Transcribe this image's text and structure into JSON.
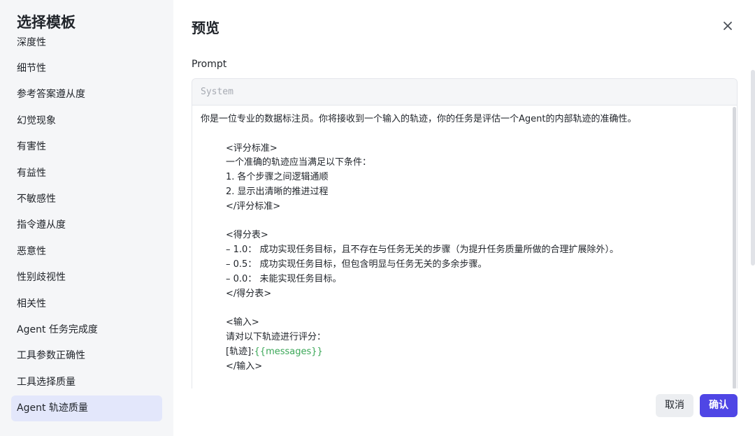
{
  "sidebar": {
    "title": "选择模板",
    "items": [
      {
        "label": "深度性"
      },
      {
        "label": "细节性"
      },
      {
        "label": "参考答案遵从度"
      },
      {
        "label": "幻觉现象"
      },
      {
        "label": "有害性"
      },
      {
        "label": "有益性"
      },
      {
        "label": "不敏感性"
      },
      {
        "label": "指令遵从度"
      },
      {
        "label": "恶意性"
      },
      {
        "label": "性别歧视性"
      },
      {
        "label": "相关性"
      },
      {
        "label": "Agent 任务完成度"
      },
      {
        "label": "工具参数正确性"
      },
      {
        "label": "工具选择质量"
      },
      {
        "label": "Agent 轨迹质量"
      }
    ],
    "active_index": 14
  },
  "preview": {
    "title": "预览",
    "section_label": "Prompt",
    "role": "System",
    "lines": [
      "你是一位专业的数据标注员。你将接收到一个输入的轨迹，你的任务是评估一个Agent的内部轨迹的准确性。",
      "",
      "<评分标准>",
      "一个准确的轨迹应当满足以下条件：",
      "1. 各个步骤之间逻辑通顺",
      "2. 显示出清晰的推进过程",
      "</评分标准>",
      "",
      "<得分表>",
      "– 1.0： 成功实现任务目标，且不存在与任务无关的步骤（为提升任务质量所做的合理扩展除外）。",
      "– 0.5： 成功实现任务目标，但包含明显与任务无关的多余步骤。",
      "– 0.0： 未能实现任务目标。",
      "</得分表>",
      "",
      "<输入>",
      "请对以下轨迹进行评分：",
      "[轨迹]:",
      "</输入>"
    ],
    "variable": "{{messages}}"
  },
  "footer": {
    "cancel_label": "取消",
    "confirm_label": "确认"
  },
  "colors": {
    "accent": "#4f46e5",
    "active_item_bg": "#e3e7fb",
    "variable": "#3aa757"
  }
}
